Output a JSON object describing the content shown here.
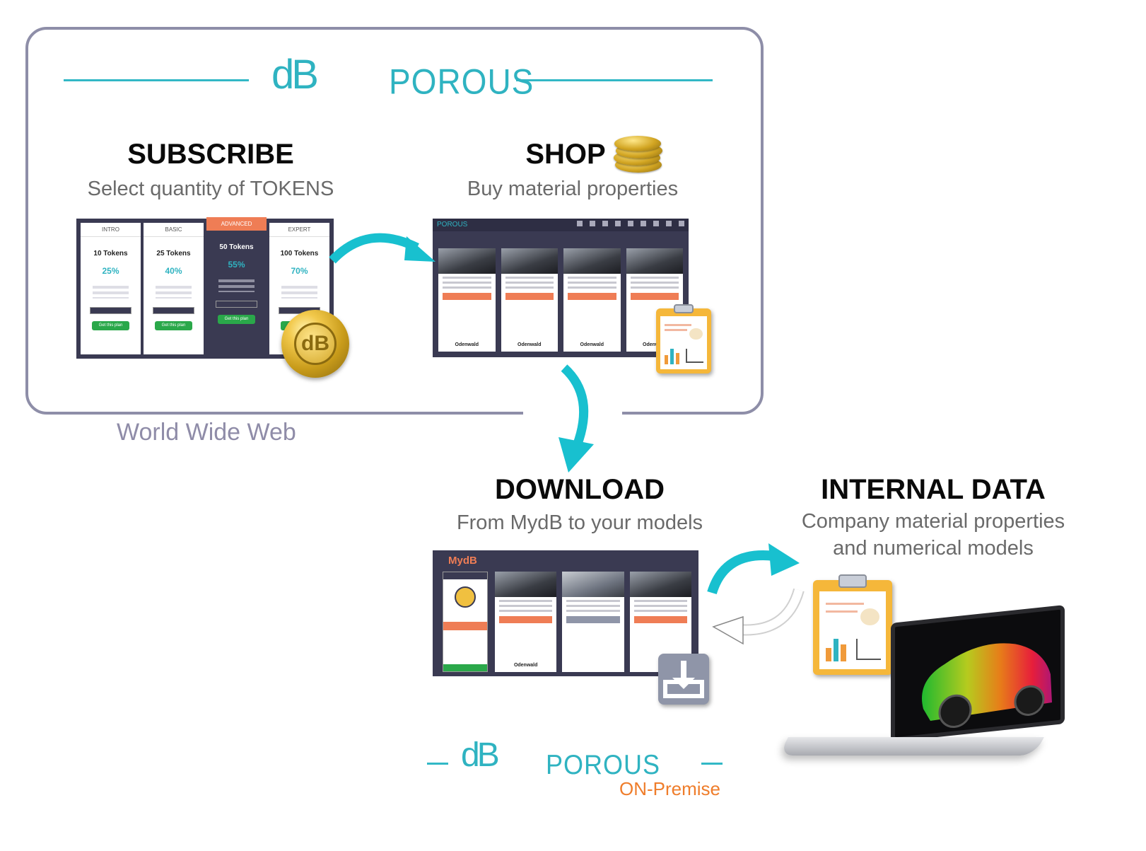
{
  "brand_top": {
    "db": "dB",
    "porous": "POROUS"
  },
  "brand_bottom": {
    "db": "dB",
    "porous": "POROUS",
    "edition": "ON-Premise"
  },
  "web_label": "World Wide Web",
  "steps": {
    "subscribe": {
      "title": "SUBSCRIBE",
      "subtitle": "Select quantity of TOKENS"
    },
    "shop": {
      "title": "SHOP",
      "subtitle": "Buy material properties"
    },
    "download": {
      "title": "DOWNLOAD",
      "subtitle": "From MydB to your models"
    },
    "internal": {
      "title": "INTERNAL DATA",
      "subtitle_line1": "Company material properties",
      "subtitle_line2": "and numerical models"
    }
  },
  "pricing_plans": [
    {
      "name": "INTRO",
      "tokens": "10 Tokens",
      "discount": "25%",
      "button": "Get this plan"
    },
    {
      "name": "BASIC",
      "tokens": "25 Tokens",
      "discount": "40%",
      "button": "Get this plan"
    },
    {
      "name": "ADVANCED",
      "tokens": "50 Tokens",
      "discount": "55%",
      "button": "Get this plan"
    },
    {
      "name": "EXPERT",
      "tokens": "100 Tokens",
      "discount": "70%",
      "button": "Get this plan"
    }
  ],
  "shop_brand": "Odenwald",
  "mydb_title": "MydB",
  "colors": {
    "teal": "#2fb3c1",
    "orange": "#ef7d2b",
    "frame": "#8e8ea8",
    "dark_panel": "#3a3a52"
  },
  "icons": [
    "coin-icon",
    "coin-stack-icon",
    "clipboard-report-icon",
    "download-icon",
    "laptop-icon"
  ]
}
